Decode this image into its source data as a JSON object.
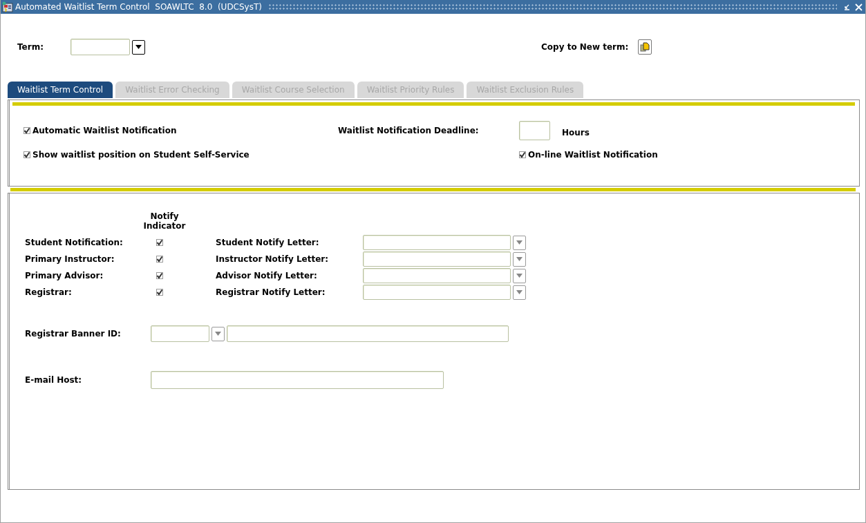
{
  "window": {
    "title": "Automated Waitlist Term Control  SOAWLTC  8.0  (UDCSysT)"
  },
  "key_block": {
    "term_label": "Term:",
    "copy_label": "Copy to New term:"
  },
  "tabs": [
    {
      "label": "Waitlist Term Control",
      "selected": true
    },
    {
      "label": "Waitlist Error Checking",
      "selected": false
    },
    {
      "label": "Waitlist Course Selection",
      "selected": false
    },
    {
      "label": "Waitlist Priority Rules",
      "selected": false
    },
    {
      "label": "Waitlist Exclusion Rules",
      "selected": false
    }
  ],
  "options": {
    "automatic_notification": {
      "label": "Automatic Waitlist Notification",
      "checked": true
    },
    "show_position": {
      "label": "Show waitlist position on Student Self-Service",
      "checked": true
    },
    "deadline_label": "Waitlist Notification Deadline:",
    "deadline_unit": "Hours",
    "online_notification": {
      "label": "On-line Waitlist Notification",
      "checked": true
    }
  },
  "notify": {
    "header": "Notify Indicator",
    "rows": [
      {
        "label": "Student Notification:",
        "checked": true,
        "letter_label": "Student Notify Letter:"
      },
      {
        "label": "Primary Instructor:",
        "checked": true,
        "letter_label": "Instructor Notify Letter:"
      },
      {
        "label": "Primary Advisor:",
        "checked": true,
        "letter_label": "Advisor Notify Letter:"
      },
      {
        "label": "Registrar:",
        "checked": true,
        "letter_label": "Registrar Notify Letter:"
      }
    ],
    "banner_id_label": "Registrar Banner ID:",
    "email_host_label": "E-mail Host:"
  }
}
